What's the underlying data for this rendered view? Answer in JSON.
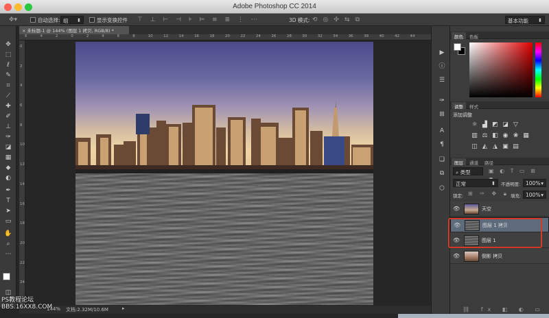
{
  "window": {
    "title": "Adobe Photoshop CC 2014",
    "workspace": "基本功能"
  },
  "options_bar": {
    "auto_select_label": "自动选择:",
    "auto_select_value": "组",
    "show_transform_label": "显示变换控件",
    "mode_3d_label": "3D 模式:"
  },
  "document": {
    "tab_label": "未标题-1 @ 144% (图层 1 拷贝, RGB/8) *"
  },
  "ruler_top_labels": [
    "6",
    "4",
    "2",
    "0",
    "2",
    "4",
    "6",
    "8",
    "10",
    "12",
    "14",
    "16",
    "18",
    "20",
    "22",
    "24",
    "26",
    "28",
    "30",
    "32",
    "34",
    "36",
    "38",
    "40",
    "42",
    "44"
  ],
  "ruler_left_labels": [
    "0",
    "2",
    "4",
    "6",
    "8",
    "10",
    "12",
    "14",
    "16",
    "18",
    "20",
    "22",
    "24"
  ],
  "status": {
    "zoom": "144%",
    "doc_size": "文档:2.32M/10.6M"
  },
  "color_panel": {
    "tabs": [
      "颜色",
      "色板"
    ]
  },
  "adjust_panel": {
    "tabs": [
      "调整",
      "样式"
    ],
    "title": "添加调整"
  },
  "layers_panel": {
    "tabs": [
      "图层",
      "通道",
      "路径"
    ],
    "filter_kind": "类型",
    "blend_mode": "正常",
    "opacity_label": "不透明度:",
    "opacity_value": "100%",
    "lock_label": "锁定:",
    "fill_label": "填充:",
    "fill_value": "100%",
    "layers": [
      {
        "name": "天空",
        "thumb": "sky",
        "selected": false
      },
      {
        "name": "图层 1 拷贝",
        "thumb": "noise",
        "selected": true
      },
      {
        "name": "图层 1",
        "thumb": "noise",
        "selected": false
      },
      {
        "name": "倒影 拷贝",
        "thumb": "city",
        "selected": false
      }
    ]
  },
  "watermark": {
    "line1": "PS教程论坛",
    "line2": "BBS.16XX8.COM"
  },
  "colors": {
    "highlight_red": "#d43a24",
    "selected_layer": "#5e6b7d"
  }
}
